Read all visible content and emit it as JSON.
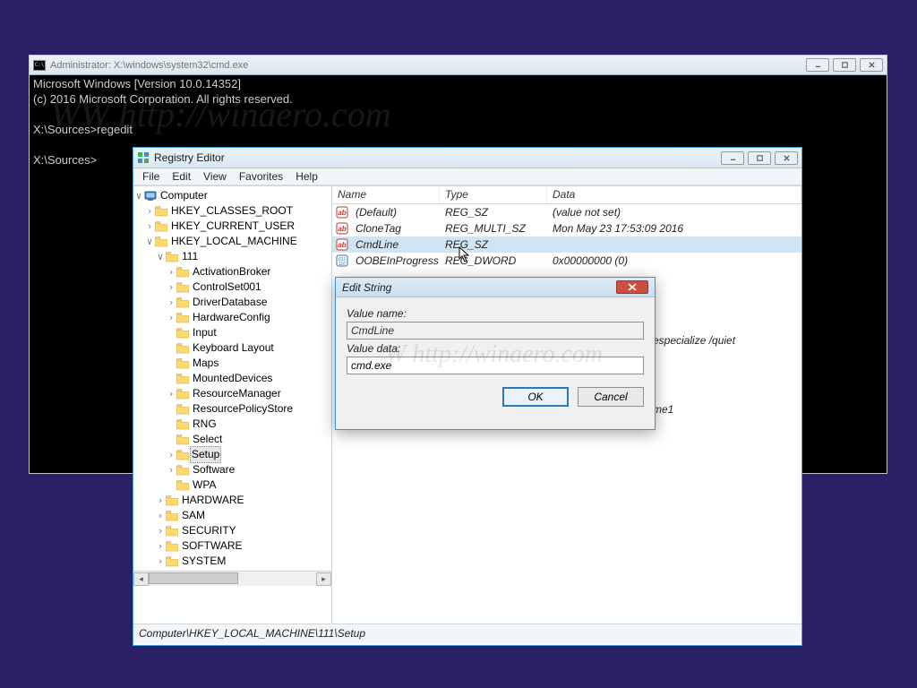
{
  "cmd": {
    "title": "Administrator: X:\\windows\\system32\\cmd.exe",
    "line1": "Microsoft Windows [Version 10.0.14352]",
    "line2": "(c) 2016 Microsoft Corporation. All rights reserved.",
    "line3": "",
    "line4": "X:\\Sources>regedit",
    "line5": "",
    "line6": "X:\\Sources>"
  },
  "watermark1": "WW http://winaero.com",
  "watermark2": "W http://winaero.com",
  "reg": {
    "title": "Registry Editor",
    "menu": {
      "file": "File",
      "edit": "Edit",
      "view": "View",
      "favorites": "Favorites",
      "help": "Help"
    },
    "statusbar": "Computer\\HKEY_LOCAL_MACHINE\\111\\Setup",
    "cols": {
      "name": "Name",
      "type": "Type",
      "data": "Data"
    },
    "rows": [
      {
        "name": "(Default)",
        "type": "REG_SZ",
        "data": "(value not set)",
        "icon": "str"
      },
      {
        "name": "CloneTag",
        "type": "REG_MULTI_SZ",
        "data": "Mon May 23 17:53:09 2016",
        "icon": "str"
      },
      {
        "name": "CmdLine",
        "type": "REG_SZ",
        "data": "",
        "icon": "str",
        "selected": true
      },
      {
        "name": "OOBEInProgress",
        "type": "REG_DWORD",
        "data": "0x00000000 (0)",
        "icon": "bin"
      }
    ],
    "tree": {
      "root": "Computer",
      "n0": "HKEY_CLASSES_ROOT",
      "n1": "HKEY_CURRENT_USER",
      "n2": "HKEY_LOCAL_MACHINE",
      "n3": "111",
      "c": [
        "ActivationBroker",
        "ControlSet001",
        "DriverDatabase",
        "HardwareConfig",
        "Input",
        "Keyboard Layout",
        "Maps",
        "MountedDevices",
        "ResourceManager",
        "ResourcePolicyStore",
        "RNG",
        "Select",
        "Setup",
        "Software",
        "WPA"
      ],
      "s": [
        "HARDWARE",
        "SAM",
        "SECURITY",
        "SOFTWARE",
        "SYSTEM"
      ]
    }
  },
  "extra1": "especialize /quiet",
  "extra2": "me1",
  "dlg": {
    "title": "Edit String",
    "label1": "Value name:",
    "val1": "CmdLine",
    "label2": "Value data:",
    "val2": "cmd.exe",
    "ok": "OK",
    "cancel": "Cancel"
  }
}
